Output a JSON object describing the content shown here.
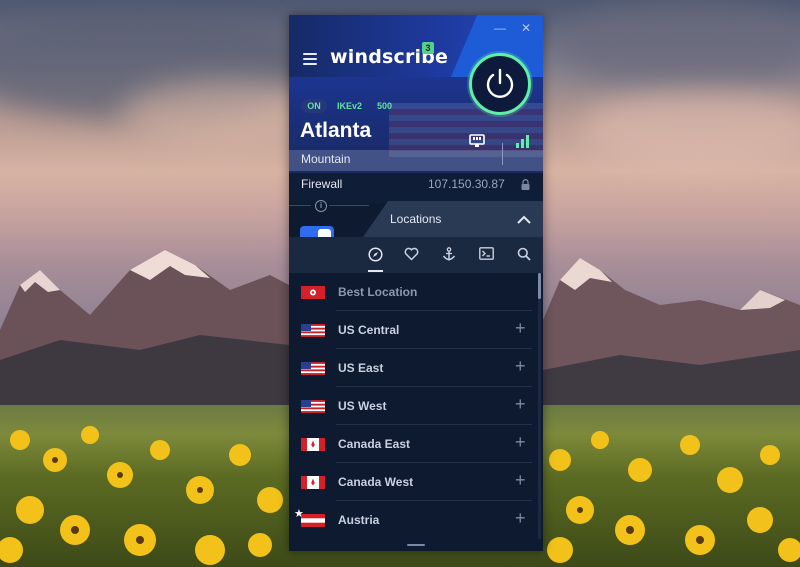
{
  "app": {
    "logo_text": "windscribe",
    "notification_count": "3",
    "minimize_glyph": "—",
    "close_glyph": "✕"
  },
  "connection": {
    "status": "ON",
    "protocol": "IKEv2",
    "port": "500",
    "city": "Atlanta",
    "nickname": "Mountain"
  },
  "firewall": {
    "label": "Firewall",
    "ip": "107.150.30.87",
    "enabled": true
  },
  "locations": {
    "header": "Locations",
    "tabs": [
      "compass-icon",
      "heart-icon",
      "anchor-icon",
      "terminal-icon",
      "search-icon"
    ],
    "active_tab": "compass-icon",
    "items": [
      {
        "name": "Best Location",
        "flag": "hong-kong"
      },
      {
        "name": "US Central",
        "flag": "usa"
      },
      {
        "name": "US East",
        "flag": "usa"
      },
      {
        "name": "US West",
        "flag": "usa"
      },
      {
        "name": "Canada East",
        "flag": "canada"
      },
      {
        "name": "Canada West",
        "flag": "canada"
      },
      {
        "name": "Austria",
        "flag": "austria"
      }
    ]
  },
  "colors": {
    "accent_green": "#5ff0a8",
    "brand_blue": "#2f6cf0",
    "panel_bg": "#0e1a30"
  }
}
